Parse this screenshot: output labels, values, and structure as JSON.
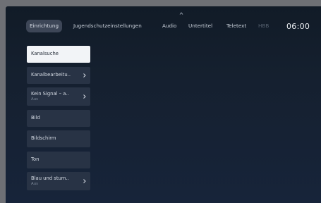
{
  "tabs": [
    {
      "label": "Einrichtung",
      "active": true
    },
    {
      "label": "Jugendschutzeinstellungen"
    },
    {
      "label": "Audio"
    },
    {
      "label": "Untertitel"
    },
    {
      "label": "Teletext"
    },
    {
      "label": "HBB"
    }
  ],
  "clock": "06:00",
  "menu": {
    "items": [
      {
        "label": "Kanalsuche",
        "selected": true
      },
      {
        "label": "Kanalbearbeitu..",
        "chevron": true
      },
      {
        "label": "Kein Signal – a..",
        "sub": "Aus",
        "chevron": true
      },
      {
        "label": "Bild"
      },
      {
        "label": "Bildschirm"
      },
      {
        "label": "Ton"
      },
      {
        "label": "Blau und stum..",
        "sub": "Aus",
        "chevron": true
      }
    ]
  },
  "icons": {
    "up": "chevron-up-icon",
    "right": "chevron-right-icon"
  },
  "colors": {
    "background": "#15202f",
    "selected_item": "#f2f4f7",
    "item": "#283345",
    "active_tab": "#3d4657"
  }
}
